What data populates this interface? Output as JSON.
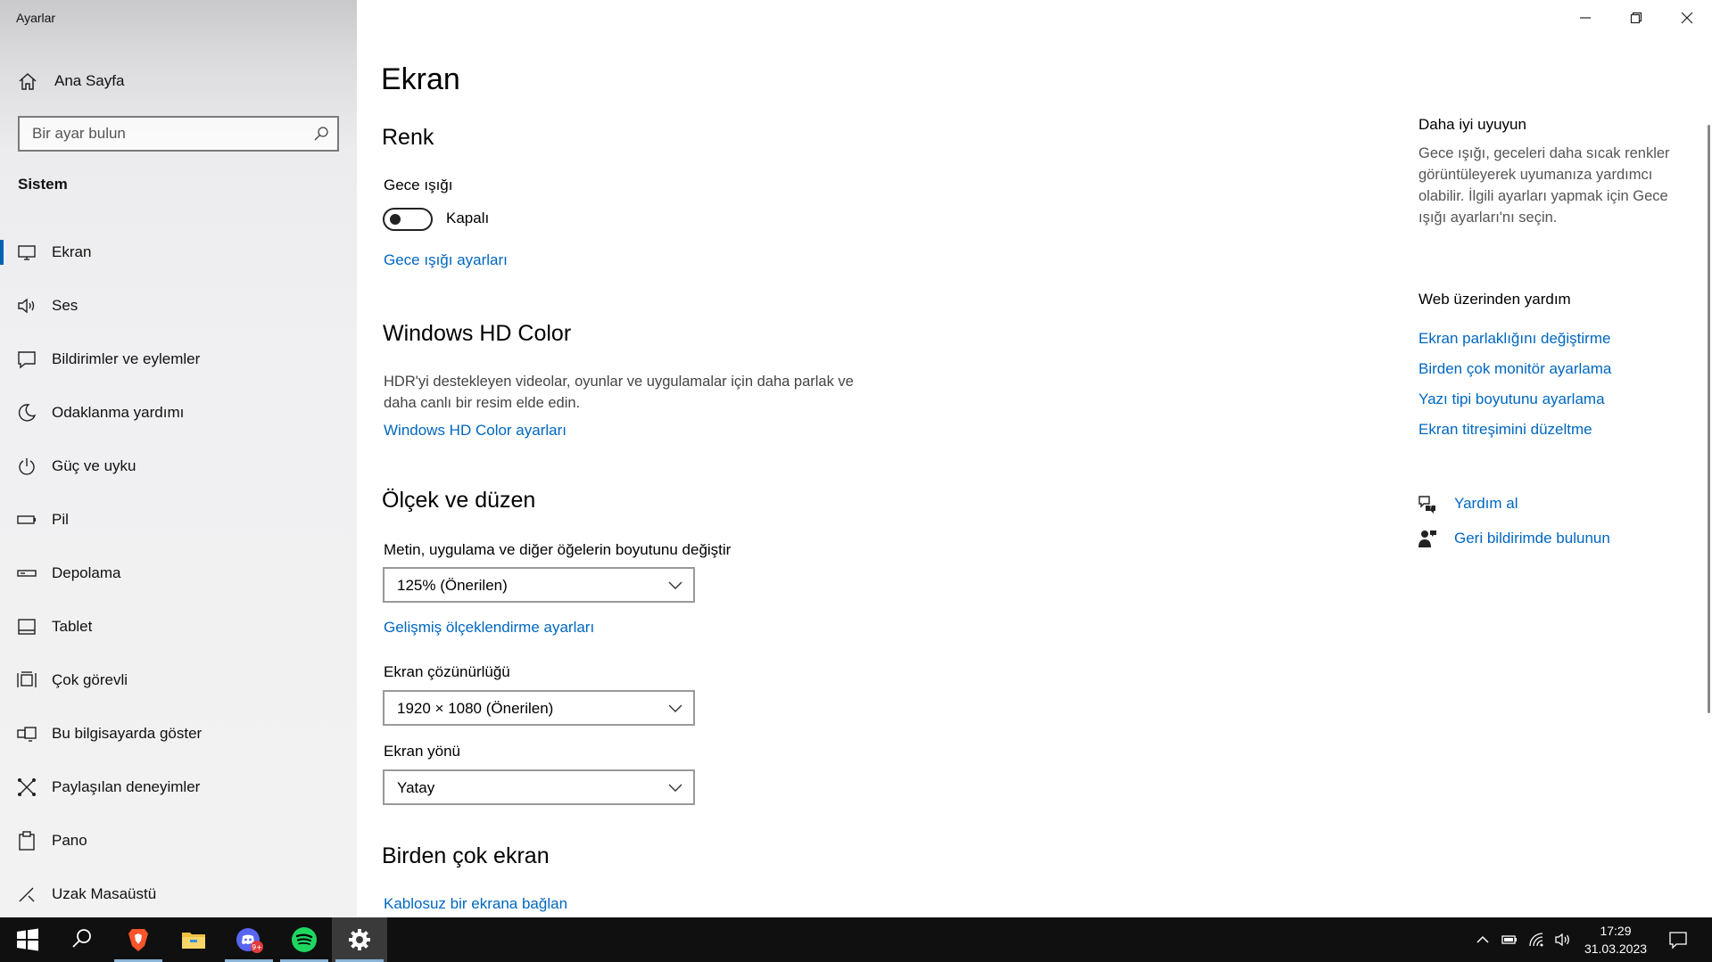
{
  "app": {
    "title": "Ayarlar"
  },
  "sidebar": {
    "home_label": "Ana Sayfa",
    "search_placeholder": "Bir ayar bulun",
    "section_label": "Sistem",
    "items": [
      {
        "label": "Ekran",
        "icon": "monitor-icon",
        "active": true
      },
      {
        "label": "Ses",
        "icon": "speaker-icon"
      },
      {
        "label": "Bildirimler ve eylemler",
        "icon": "notification-icon"
      },
      {
        "label": "Odaklanma yardımı",
        "icon": "moon-icon"
      },
      {
        "label": "Güç ve uyku",
        "icon": "power-icon"
      },
      {
        "label": "Pil",
        "icon": "battery-icon"
      },
      {
        "label": "Depolama",
        "icon": "storage-icon"
      },
      {
        "label": "Tablet",
        "icon": "tablet-icon"
      },
      {
        "label": "Çok görevli",
        "icon": "multitasking-icon"
      },
      {
        "label": "Bu bilgisayarda göster",
        "icon": "projecting-icon"
      },
      {
        "label": "Paylaşılan deneyimler",
        "icon": "shared-experiences-icon"
      },
      {
        "label": "Pano",
        "icon": "clipboard-icon"
      },
      {
        "label": "Uzak Masaüstü",
        "icon": "remote-desktop-icon"
      }
    ]
  },
  "main": {
    "title": "Ekran",
    "color": {
      "heading": "Renk",
      "night_light_label": "Gece ışığı",
      "night_light_state": "Kapalı",
      "night_light_settings_link": "Gece ışığı ayarları"
    },
    "hdr": {
      "heading": "Windows HD Color",
      "desc_line1": "HDR'yi destekleyen videolar, oyunlar ve uygulamalar için daha parlak ve",
      "desc_line2": "daha canlı bir resim elde edin.",
      "link": "Windows HD Color ayarları"
    },
    "scale": {
      "heading": "Ölçek ve düzen",
      "size_label": "Metin, uygulama ve diğer öğelerin boyutunu değiştir",
      "size_value": "125% (Önerilen)",
      "advanced_link": "Gelişmiş ölçeklendirme ayarları",
      "resolution_label": "Ekran çözünürlüğü",
      "resolution_value": "1920 × 1080 (Önerilen)",
      "orientation_label": "Ekran yönü",
      "orientation_value": "Yatay"
    },
    "multi": {
      "heading": "Birden çok ekran",
      "wireless_link": "Kablosuz bir ekrana bağlan"
    }
  },
  "right_panel": {
    "sleep_heading": "Daha iyi uyuyun",
    "sleep_desc_1": "Gece ışığı, geceleri daha sıcak renkler",
    "sleep_desc_2": "görüntüleyerek uyumanıza yardımcı",
    "sleep_desc_3": "olabilir. İlgili ayarları yapmak için Gece",
    "sleep_desc_4": "ışığı ayarları'nı seçin.",
    "web_help_heading": "Web üzerinden yardım",
    "web_links": [
      "Ekran parlaklığını değiştirme",
      "Birden çok monitör ayarlama",
      "Yazı tipi boyutunu ayarlama",
      "Ekran titreşimini düzeltme"
    ],
    "get_help": "Yardım al",
    "feedback": "Geri bildirimde bulunun"
  },
  "taskbar": {
    "apps": [
      "start-icon",
      "search-icon",
      "brave-icon",
      "file-explorer-icon",
      "discord-icon",
      "spotify-icon",
      "settings-icon"
    ],
    "discord_badge": "9+",
    "time": "17:29",
    "date": "31.03.2023"
  },
  "colors": {
    "accent": "#0067c0",
    "nav_indicator": "#0063b1",
    "taskbar": "#101010",
    "spotify": "#1ed760",
    "brave": "#fb542b"
  }
}
